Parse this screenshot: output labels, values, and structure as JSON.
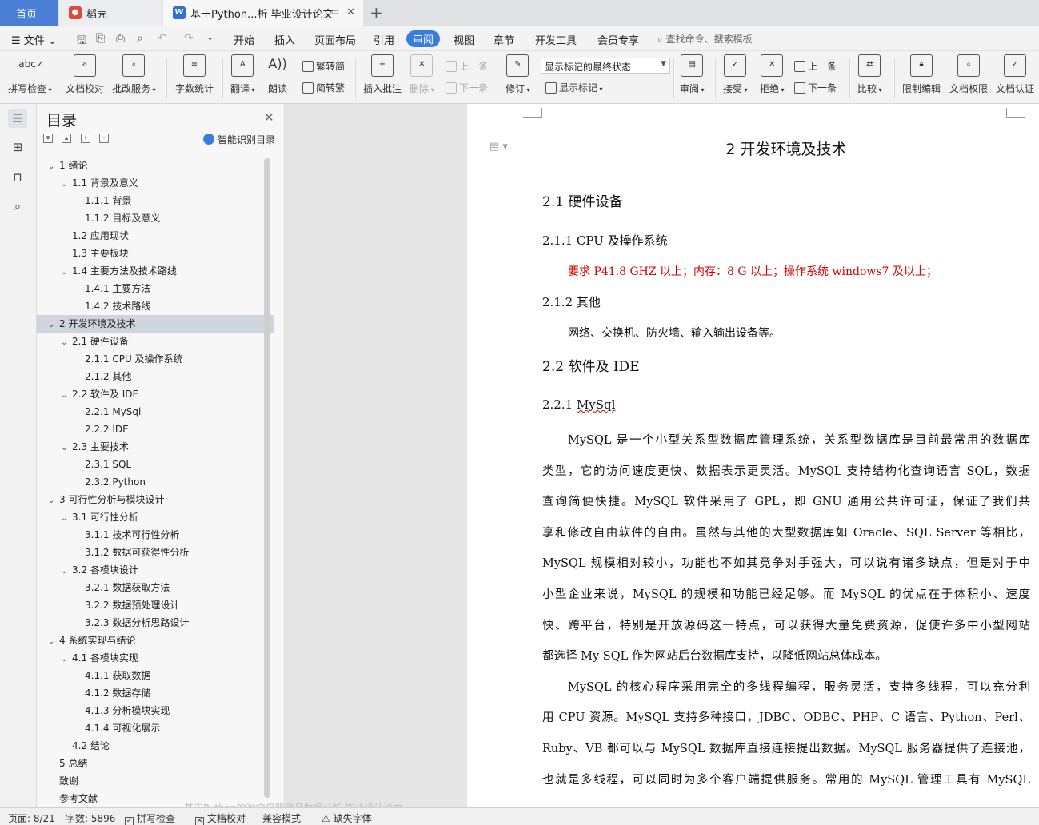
{
  "tabs": {
    "home": "首页",
    "daoke": "稻壳",
    "doc": "基于Python...析 毕业设计论文",
    "add": "+"
  },
  "menu": {
    "file": "文件",
    "items": [
      "开始",
      "插入",
      "页面布局",
      "引用",
      "审阅",
      "视图",
      "章节",
      "开发工具",
      "会员专享"
    ],
    "search": "查找命令、搜索模板"
  },
  "ribbon": {
    "spellcheck": "拼写检查",
    "proofread": "文档校对",
    "batch": "批改服务",
    "wordcount": "字数统计",
    "translate": "翻译",
    "read": "朗读",
    "trad_to_simp": "繁转简",
    "simp_to_trad": "简转繁",
    "insert_comment": "插入批注",
    "delete": "删除",
    "prev_comment": "上一条",
    "next_comment": "下一条",
    "revise": "修订",
    "markup_select": "显示标记的最终状态",
    "show_markup": "显示标记",
    "review": "审阅",
    "accept": "接受",
    "reject": "拒绝",
    "prev_change": "上一条",
    "next_change": "下一条",
    "compare": "比较",
    "restrict": "限制编辑",
    "permission": "文档权限",
    "certify": "文档认证"
  },
  "toc": {
    "title": "目录",
    "smart": "智能识别目录",
    "items": [
      {
        "label": "1  绪论",
        "level": 0,
        "caret": true
      },
      {
        "label": "1.1  背景及意义",
        "level": 1,
        "caret": true
      },
      {
        "label": "1.1.1  背景",
        "level": 2,
        "caret": false
      },
      {
        "label": "1.1.2  目标及意义",
        "level": 2,
        "caret": false
      },
      {
        "label": "1.2  应用现状",
        "level": 1,
        "caret": false
      },
      {
        "label": "1.3  主要板块",
        "level": 1,
        "caret": false
      },
      {
        "label": "1.4  主要方法及技术路线",
        "level": 1,
        "caret": true
      },
      {
        "label": "1.4.1  主要方法",
        "level": 2,
        "caret": false
      },
      {
        "label": "1.4.2  技术路线",
        "level": 2,
        "caret": false
      },
      {
        "label": "2 开发环境及技术",
        "level": 0,
        "caret": true,
        "selected": true
      },
      {
        "label": "2.1 硬件设备",
        "level": 1,
        "caret": true
      },
      {
        "label": "2.1.1 CPU 及操作系统",
        "level": 2,
        "caret": false
      },
      {
        "label": "2.1.2  其他",
        "level": 2,
        "caret": false
      },
      {
        "label": "2.2 软件及 IDE",
        "level": 1,
        "caret": true
      },
      {
        "label": "2.2.1 MySql",
        "level": 2,
        "caret": false
      },
      {
        "label": "2.2.2 IDE",
        "level": 2,
        "caret": false
      },
      {
        "label": "2.3 主要技术",
        "level": 1,
        "caret": true
      },
      {
        "label": "2.3.1 SQL",
        "level": 2,
        "caret": false
      },
      {
        "label": "2.3.2 Python",
        "level": 2,
        "caret": false
      },
      {
        "label": "3  可行性分析与模块设计",
        "level": 0,
        "caret": true
      },
      {
        "label": "3.1  可行性分析",
        "level": 1,
        "caret": true
      },
      {
        "label": "3.1.1  技术可行性分析",
        "level": 2,
        "caret": false
      },
      {
        "label": "3.1.2  数据可获得性分析",
        "level": 2,
        "caret": false
      },
      {
        "label": "3.2  各模块设计",
        "level": 1,
        "caret": true
      },
      {
        "label": "3.2.1  数据获取方法",
        "level": 2,
        "caret": false
      },
      {
        "label": "3.2.2  数据预处理设计",
        "level": 2,
        "caret": false
      },
      {
        "label": "3.2.3  数据分析思路设计",
        "level": 2,
        "caret": false
      },
      {
        "label": "4  系统实现与结论",
        "level": 0,
        "caret": true
      },
      {
        "label": "4.1  各模块实现",
        "level": 1,
        "caret": true
      },
      {
        "label": "4.1.1  获取数据",
        "level": 2,
        "caret": false
      },
      {
        "label": "4.1.2  数据存储",
        "level": 2,
        "caret": false
      },
      {
        "label": "4.1.3  分析模块实现",
        "level": 2,
        "caret": false
      },
      {
        "label": "4.1.4  可视化展示",
        "level": 2,
        "caret": false
      },
      {
        "label": "4.2  结论",
        "level": 1,
        "caret": false
      },
      {
        "label": "5 总结",
        "level": 0,
        "caret": false
      },
      {
        "label": "致谢",
        "level": 0,
        "caret": false
      },
      {
        "label": "参考文献",
        "level": 0,
        "caret": false
      }
    ]
  },
  "doc": {
    "ch2": "2 开发环境及技术",
    "h21": "2.1 硬件设备",
    "h211": "2.1.1 CPU 及操作系统",
    "cpu": "要求 P41.8 GHZ 以上；内存：8 G 以上；操作系统 windows7 及以上；",
    "h212": "2.1.2  其他",
    "other": "网络、交换机、防火墙、输入输出设备等。",
    "h22": "2.2 软件及 IDE",
    "h221_num": "2.2.1 ",
    "h221_word": "MySql",
    "body_lines": [
      "MySQL 是一个小型关系型数据库管理系统，关系型数据库是目前最常用的数据库",
      "类型，它的访问速度更快、数据表示更灵活。MySQL 支持结构化查询语言 SQL，数据",
      "查询简便快捷。MySQL 软件采用了 GPL，即 GNU 通用公共许可证，保证了我们共",
      "享和修改自由软件的自由。虽然与其他的大型数据库如 Oracle、SQL Server 等相比，",
      "MySQL 规模相对较小，功能也不如其竞争对手强大，可以说有诸多缺点，但是对于中",
      "小型企业来说，MySQL 的规模和功能已经足够。而 MySQL 的优点在于体积小、速度",
      "快、跨平台，特别是开放源码这一特点，可以获得大量免费资源，促使许多中小型网站",
      "都选择 My SQL 作为网站后台数据库支持，以降低网站总体成本。",
      "MySQL 的核心程序采用完全的多线程编程，服务灵活，支持多线程，可以充分利",
      "用 CPU 资源。MySQL 支持多种接口，JDBC、ODBC、PHP、C 语言、Python、Perl、",
      "Ruby、VB 都可以与 MySQL 数据库直接连接提出数据。MySQL 服务器提供了连接池，",
      "也就是多线程，可以同时为多个客户端提供服务。常用的 MySQL 管理工具有 MySQL"
    ]
  },
  "ghost_tip": "基于Python的淘宝母婴用品数据分析 毕业设计论文",
  "status": {
    "page": "页面: 8/21",
    "words": "字数: 5896",
    "spell": "拼写检查",
    "proof": "文档校对",
    "compat": "兼容模式",
    "missing_font": "缺失字体"
  }
}
